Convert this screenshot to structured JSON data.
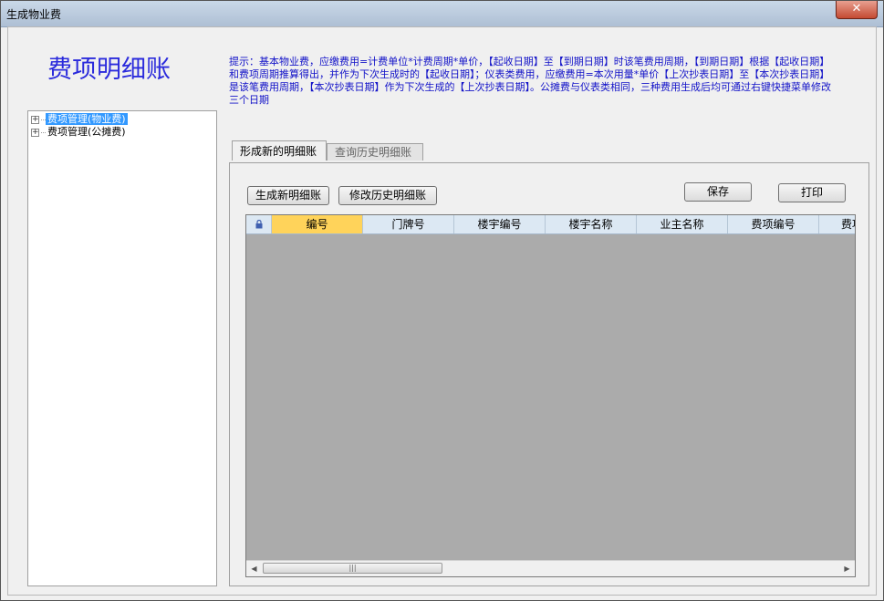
{
  "window": {
    "title": "生成物业费",
    "close_label": "✕"
  },
  "page_title": "费项明细账",
  "hint": "提示：基本物业费，应缴费用=计费单位*计费周期*单价，【起收日期】至【到期日期】时该笔费用周期，【到期日期】根据【起收日期】和费项周期推算得出，并作为下次生成时的【起收日期】；仪表类费用，应缴费用=本次用量*单价【上次抄表日期】至【本次抄表日期】是该笔费用周期，【本次抄表日期】作为下次生成的【上次抄表日期】。公摊费与仪表类相同，三种费用生成后均可通过右键快捷菜单修改三个日期",
  "tree": {
    "items": [
      {
        "label": "费项管理(物业费)",
        "selected": true
      },
      {
        "label": "费项管理(公摊费)",
        "selected": false
      }
    ]
  },
  "tabs": [
    {
      "label": "形成新的明细账",
      "active": true
    },
    {
      "label": "查询历史明细账",
      "active": false
    }
  ],
  "buttons": {
    "generate": "生成新明细账",
    "modify": "修改历史明细账",
    "save": "保存",
    "print": "打印"
  },
  "grid": {
    "columns": [
      "编号",
      "门牌号",
      "楼宇编号",
      "楼宇名称",
      "业主名称",
      "费项编号",
      "费项"
    ],
    "active_column": "编号",
    "background_color": "#ababab",
    "header_color": "#dce8f3"
  },
  "scrollbar": {
    "left_arrow": "◀",
    "right_arrow": "▶",
    "thumb_grip": "|||"
  },
  "colors": {
    "title": "#2b2bdc",
    "hint": "#1212c8",
    "selection": "#3399ff"
  }
}
